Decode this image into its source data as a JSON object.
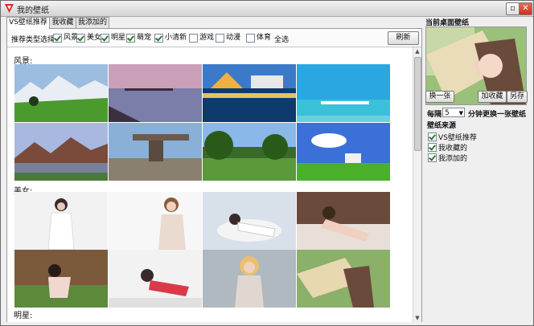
{
  "window": {
    "title": "我的壁纸"
  },
  "tabs": [
    "VS壁纸推荐",
    "我收藏的",
    "我添加的"
  ],
  "filter": {
    "label": "推荐类型选择",
    "options": [
      {
        "label": "风景",
        "checked": true
      },
      {
        "label": "美女",
        "checked": true
      },
      {
        "label": "明星",
        "checked": true
      },
      {
        "label": "萌宠",
        "checked": true
      },
      {
        "label": "小清新",
        "checked": true
      },
      {
        "label": "游戏",
        "checked": false
      },
      {
        "label": "动漫",
        "checked": false
      },
      {
        "label": "体育",
        "checked": false
      }
    ],
    "select_all": "全选",
    "refresh": "刷新"
  },
  "gallery": {
    "categories": [
      {
        "title": "风景:"
      },
      {
        "title": "美女:"
      },
      {
        "title": "明星:"
      }
    ]
  },
  "sidebar": {
    "title": "当前桌面壁纸",
    "change_button": "换一张",
    "favorite_button": "加收藏",
    "save_as_button": "另存",
    "interval_prefix": "每隔",
    "interval_value": "5",
    "interval_suffix": "分钟更换一张壁纸",
    "source_title": "壁纸来源",
    "sources": [
      {
        "label": "VS壁纸推荐",
        "checked": true
      },
      {
        "label": "我收藏的",
        "checked": true
      },
      {
        "label": "我添加的",
        "checked": true
      }
    ]
  },
  "colors": {
    "accent_check": "#2f7a2f",
    "close_button": "#c8311f"
  }
}
